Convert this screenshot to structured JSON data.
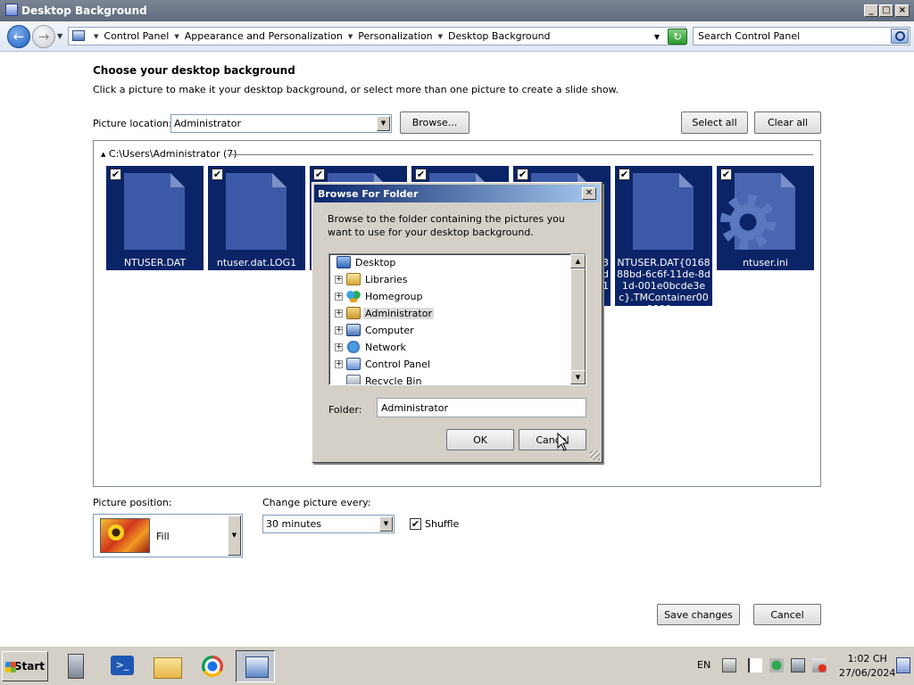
{
  "window": {
    "title": "Desktop Background"
  },
  "address": {
    "crumbs": [
      "Control Panel",
      "Appearance and Personalization",
      "Personalization",
      "Desktop Background"
    ],
    "search_placeholder": "Search Control Panel"
  },
  "main": {
    "heading": "Choose your desktop background",
    "subheading": "Click a picture to make it your desktop background, or select more than one picture to create a slide show.",
    "picture_location_label": "Picture location:",
    "picture_location_value": "Administrator",
    "browse_button": "Browse...",
    "select_all_button": "Select all",
    "clear_all_button": "Clear all",
    "group_header": "C:\\Users\\Administrator (7)",
    "tiles": [
      {
        "label": "NTUSER.DAT",
        "checked": true
      },
      {
        "label": "ntuser.dat.LOG1",
        "checked": true
      },
      {
        "label": "",
        "checked": true
      },
      {
        "label": "",
        "checked": true
      },
      {
        "label": "",
        "checked": true
      },
      {
        "label": "NTUSER.DAT{016888bd-6c6f-11de-8d1d-001e0bcde3ec}.TMContainer000000...",
        "checked": true
      },
      {
        "label": "ntuser.ini",
        "checked": true
      }
    ],
    "partial_tile_text": {
      "tile3_right": "",
      "tile5_right": "3\nd\n1"
    },
    "picture_position_label": "Picture position:",
    "picture_position_value": "Fill",
    "change_interval_label": "Change picture every:",
    "change_interval_value": "30 minutes",
    "shuffle_label": "Shuffle",
    "shuffle_checked": true,
    "save_button": "Save changes",
    "cancel_button": "Cancel"
  },
  "dialog": {
    "title": "Browse For Folder",
    "instruction": "Browse to the folder containing the pictures you want to use for your desktop background.",
    "tree": [
      {
        "label": "Desktop",
        "icon": "desktop-icon",
        "expandable": false,
        "selected": false
      },
      {
        "label": "Libraries",
        "icon": "libraries-icon",
        "expandable": true,
        "selected": false
      },
      {
        "label": "Homegroup",
        "icon": "homegroup-icon",
        "expandable": true,
        "selected": false
      },
      {
        "label": "Administrator",
        "icon": "user-folder-icon",
        "expandable": true,
        "selected": true
      },
      {
        "label": "Computer",
        "icon": "computer-icon",
        "expandable": true,
        "selected": false
      },
      {
        "label": "Network",
        "icon": "network-icon",
        "expandable": true,
        "selected": false
      },
      {
        "label": "Control Panel",
        "icon": "control-panel-icon",
        "expandable": true,
        "selected": false
      },
      {
        "label": "Recycle Bin",
        "icon": "recycle-bin-icon",
        "expandable": false,
        "selected": false
      }
    ],
    "folder_label": "Folder:",
    "folder_value": "Administrator",
    "ok_button": "OK",
    "cancel_button": "Cancel"
  },
  "taskbar": {
    "start_label": "Start",
    "language": "EN",
    "time": "1:02 CH",
    "date": "27/06/2024"
  },
  "colors": {
    "tile_bg": "#0b2468",
    "dialog_title_start": "#0a246a",
    "dialog_title_end": "#a6caf0",
    "title_bar": "#6a7486"
  }
}
